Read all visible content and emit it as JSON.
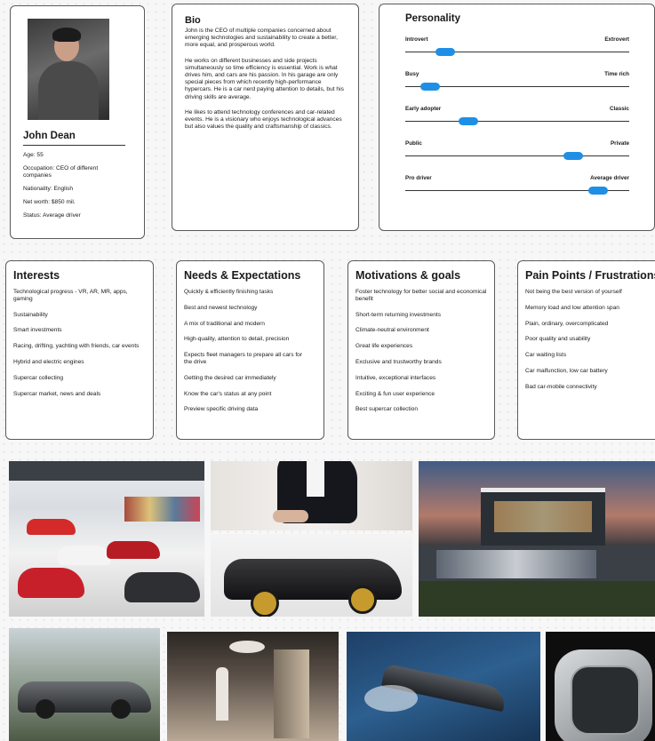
{
  "profile": {
    "name": "John Dean",
    "age": "Age: 55",
    "occupation": "Occupation: CEO of different companies",
    "nationality": "Nationality: English",
    "net_worth": "Net worth:  $850 mil.",
    "status": "Status: Average driver"
  },
  "bio": {
    "title": "Bio",
    "p1": "John is the CEO of multiple companies concerned about emerging technologies and sustainability to create a better, more equal, and prosperous world.",
    "p2": "He works on different businesses and side projects simultaneously so time efficiency is essential. Work is what drives him, and cars are his passion. In his garage are only special pieces from which recently high-performance hypercars. He is a car nerd paying attention to details, but his driving skills are average.",
    "p3": "He likes to attend technology conferences and car-related events. He is a visionary who enjoys technological advances but also values the quality and craftsmanship of classics."
  },
  "personality": {
    "title": "Personality",
    "sliders": [
      {
        "left": "Introvert",
        "right": "Extrovert",
        "value": 0.18
      },
      {
        "left": "Busy",
        "right": "Time rich",
        "value": 0.11
      },
      {
        "left": "Early adopter",
        "right": "Classic",
        "value": 0.28
      },
      {
        "left": "Public",
        "right": "Private",
        "value": 0.75
      },
      {
        "left": "Pro driver",
        "right": "Average driver",
        "value": 0.86
      }
    ],
    "accent": "#1f8fe6"
  },
  "interests": {
    "title": "Interests",
    "items": [
      "Technological progress - VR, AR, MR, apps, gaming",
      "Sustainability",
      "Smart investments",
      "Racing, drifting, yachting with friends, car events",
      "Hybrid and electric engines",
      "Supercar collecting",
      "Supercar market, news and deals"
    ]
  },
  "needs": {
    "title": "Needs & Expectations",
    "items": [
      "Quickly & efficiently finishing tasks",
      "Best and newest technology",
      "A mix of traditional and modern",
      "High-quality, attention to detail, precision",
      "Expects fleet managers to prepare all cars for the drive",
      "Getting the desired car immediately",
      "Know the car's status at any point",
      "Preview specific driving data"
    ]
  },
  "motivations": {
    "title": "Motivations & goals",
    "items": [
      "Foster technology for better social and economical benefit",
      "Short-term returning investments",
      "Climate-neutral environment",
      "Great life experiences",
      "Exclusive and trustworthy brands",
      "Intuitive, exceptional interfaces",
      "Exciting & fun user experience",
      "Best supercar collection"
    ]
  },
  "pain_points": {
    "title": "Pain Points / Frustrations",
    "items": [
      "Not being the best version of yourself",
      "Memory load and low attention span",
      "Plain, ordinary, overcomplicated",
      "Poor quality and usability",
      "Car waiting lists",
      "Car malfunction, low car battery",
      "Bad car-mobile connectivity"
    ]
  }
}
